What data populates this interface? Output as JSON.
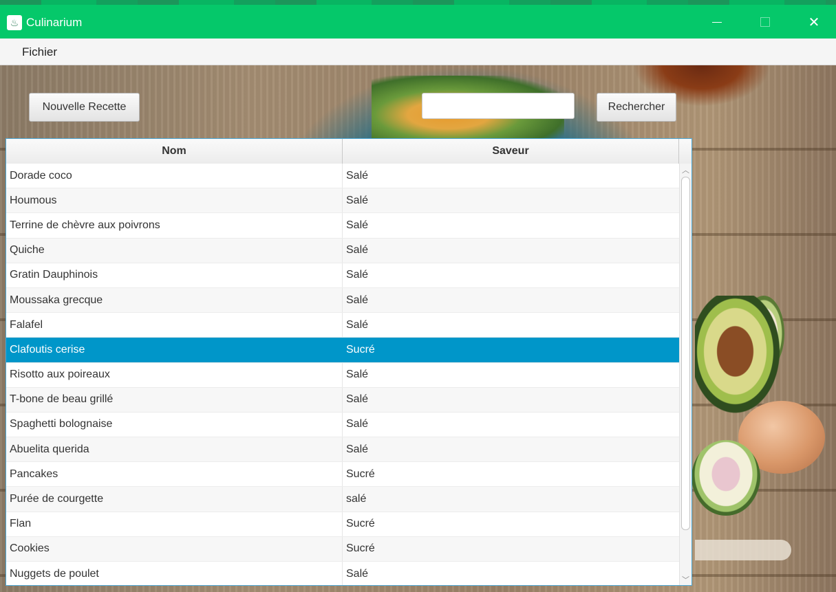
{
  "window": {
    "title": "Culinarium",
    "controls": {
      "minimize": "minimize",
      "maximize": "maximize",
      "close": "✕"
    },
    "accent_color": "#05c86a"
  },
  "menu": {
    "items": [
      {
        "label": "Fichier"
      }
    ]
  },
  "toolbar": {
    "new_recipe_label": "Nouvelle Recette",
    "search_value": "",
    "search_button_label": "Rechercher"
  },
  "table": {
    "columns": [
      "Nom",
      "Saveur"
    ],
    "selected_color": "#0096c9",
    "rows": [
      {
        "nom": "Dorade coco",
        "saveur": "Salé"
      },
      {
        "nom": "Houmous",
        "saveur": "Salé"
      },
      {
        "nom": "Terrine de chèvre aux poivrons",
        "saveur": "Salé"
      },
      {
        "nom": "Quiche",
        "saveur": "Salé"
      },
      {
        "nom": "Gratin Dauphinois",
        "saveur": "Salé"
      },
      {
        "nom": "Moussaka grecque",
        "saveur": "Salé"
      },
      {
        "nom": "Falafel",
        "saveur": "Salé"
      },
      {
        "nom": "Clafoutis cerise",
        "saveur": "Sucré",
        "selected": true
      },
      {
        "nom": "Risotto aux poireaux",
        "saveur": "Salé"
      },
      {
        "nom": "T-bone de beau grillé",
        "saveur": "Salé"
      },
      {
        "nom": "Spaghetti bolognaise",
        "saveur": "Salé"
      },
      {
        "nom": "Abuelita querida",
        "saveur": "Salé"
      },
      {
        "nom": "Pancakes",
        "saveur": "Sucré"
      },
      {
        "nom": "Purée de courgette",
        "saveur": "salé"
      },
      {
        "nom": "Flan",
        "saveur": "Sucré"
      },
      {
        "nom": "Cookies",
        "saveur": "Sucré"
      },
      {
        "nom": "Nuggets de poulet",
        "saveur": "Salé"
      }
    ]
  },
  "icons": {
    "app": "chef-hat-icon",
    "scroll_up": "chevron-up-icon",
    "scroll_down": "chevron-down-icon"
  }
}
